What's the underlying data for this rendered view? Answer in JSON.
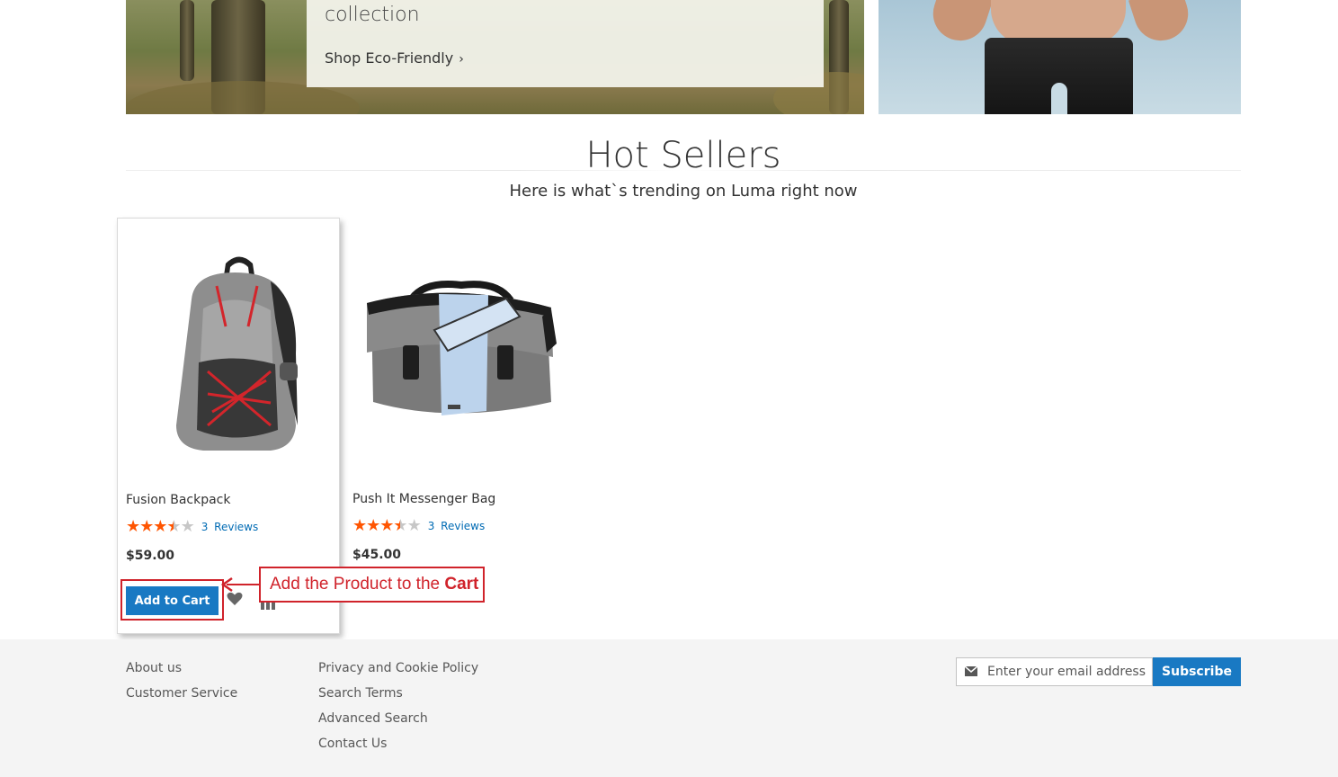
{
  "hero": {
    "collection_text": "collection",
    "shop_link": "Shop Eco-Friendly"
  },
  "hot_sellers": {
    "title": "Hot Sellers",
    "subtitle": "Here is what`s trending on Luma right now"
  },
  "products": [
    {
      "name": "Fusion Backpack",
      "rating_stars": 3.5,
      "reviews_count": "3",
      "reviews_label": "Reviews",
      "price": "$59.00",
      "add_to_cart": "Add to Cart"
    },
    {
      "name": "Push It Messenger Bag",
      "rating_stars": 3.5,
      "reviews_count": "3",
      "reviews_label": "Reviews",
      "price": "$45.00"
    }
  ],
  "annotation": {
    "text": "Add the Product to the",
    "bold": "Cart",
    "color": "#d0232b"
  },
  "footer": {
    "col1": [
      "About us",
      "Customer Service"
    ],
    "col2": [
      "Privacy and Cookie Policy",
      "Search Terms",
      "Advanced Search",
      "Contact Us"
    ],
    "newsletter": {
      "placeholder": "Enter your email address",
      "button": "Subscribe"
    }
  },
  "colors": {
    "primary": "#1979c3",
    "link": "#006bb4",
    "star": "#ff5501",
    "footer_bg": "#f4f4f4"
  }
}
